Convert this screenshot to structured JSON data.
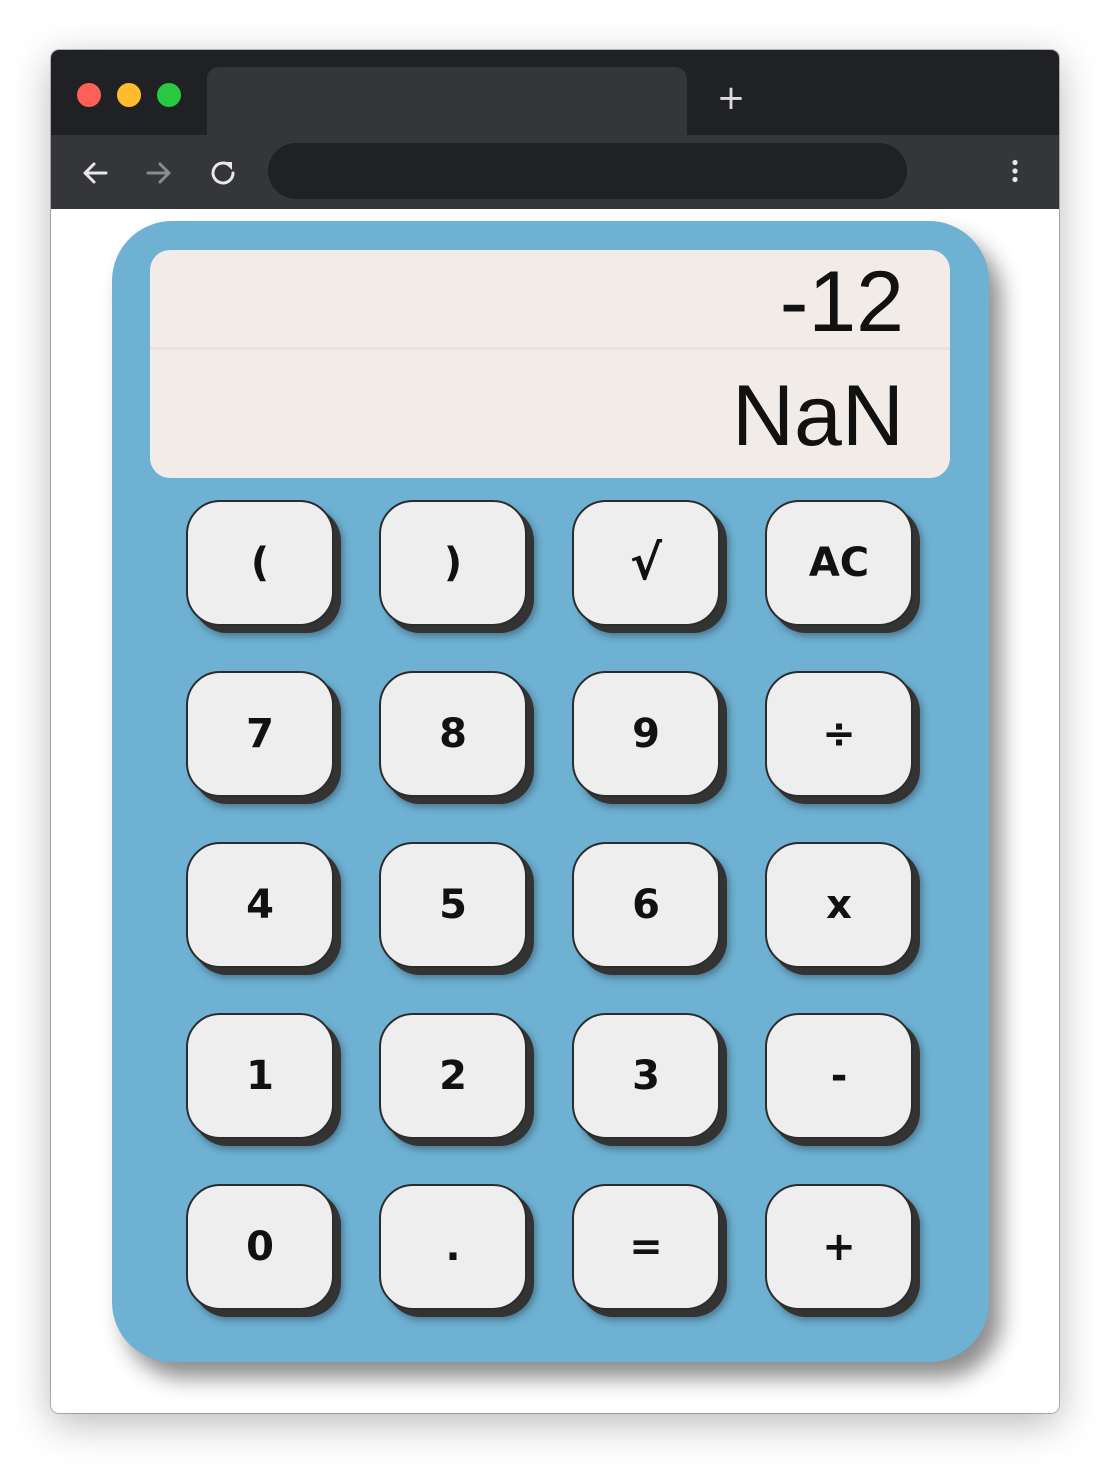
{
  "browser": {
    "tab_title": "",
    "new_tab_label": "+",
    "url": "",
    "back_icon": "arrow-left-icon",
    "forward_icon": "arrow-right-icon",
    "reload_icon": "reload-icon",
    "menu_icon": "kebab-menu-icon"
  },
  "colors": {
    "calculator_body": "#6eb1d3",
    "display_bg": "#f1ece7",
    "key_bg": "#eeeeee",
    "key_shadow": "#333333"
  },
  "display": {
    "expression": "-12",
    "result": "NaN"
  },
  "keys": {
    "open_paren": "(",
    "close_paren": ")",
    "sqrt": "√",
    "clear": "AC",
    "seven": "7",
    "eight": "8",
    "nine": "9",
    "divide": "÷",
    "four": "4",
    "five": "5",
    "six": "6",
    "multiply": "x",
    "one": "1",
    "two": "2",
    "three": "3",
    "subtract": "-",
    "zero": "0",
    "decimal": ".",
    "equals": "=",
    "add": "+"
  }
}
